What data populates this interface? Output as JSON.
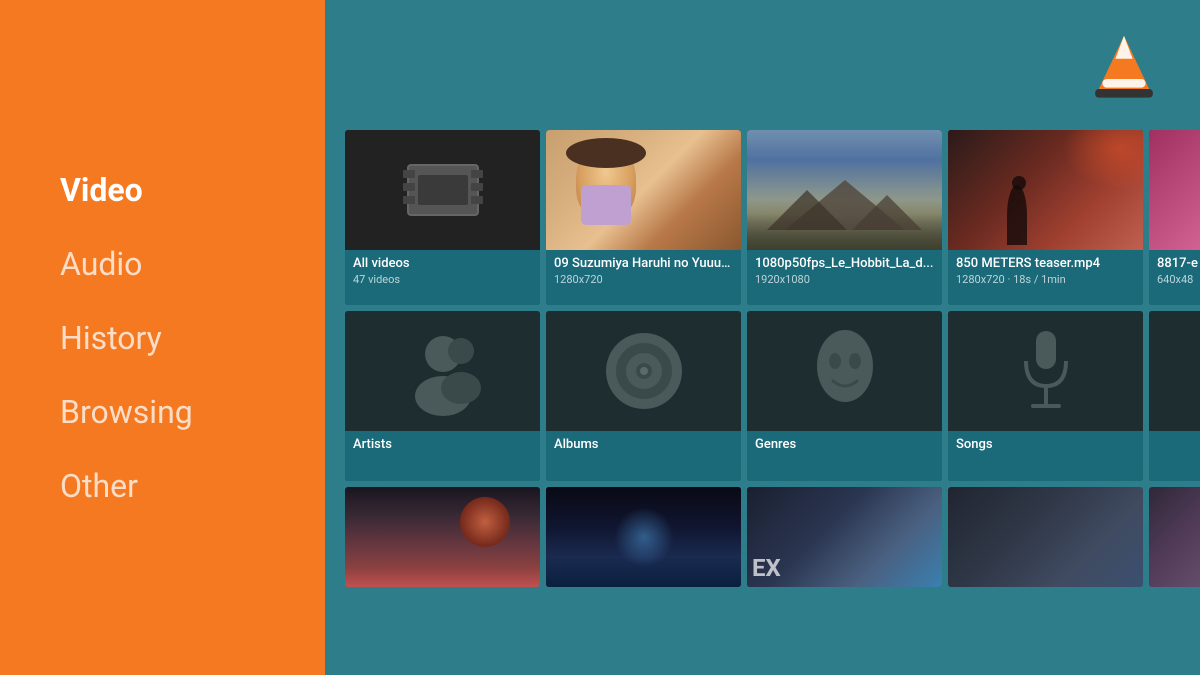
{
  "sidebar": {
    "nav_items": [
      {
        "id": "video",
        "label": "Video",
        "active": true
      },
      {
        "id": "audio",
        "label": "Audio",
        "active": false
      },
      {
        "id": "history",
        "label": "History",
        "active": false
      },
      {
        "id": "browsing",
        "label": "Browsing",
        "active": false
      },
      {
        "id": "other",
        "label": "Other",
        "active": false
      }
    ]
  },
  "vlc": {
    "logo_title": "VLC Media Player"
  },
  "video_row": {
    "tiles": [
      {
        "id": "all-videos",
        "title": "All videos",
        "subtitle": "47 videos",
        "type": "folder"
      },
      {
        "id": "suzumiya",
        "title": "09 Suzumiya Haruhi no Yuuut...",
        "subtitle": "1280x720",
        "type": "anime"
      },
      {
        "id": "hobbit",
        "title": "1080p50fps_Le_Hobbit_La_d...",
        "subtitle": "1920x1080",
        "type": "mountain"
      },
      {
        "id": "850meters",
        "title": "850 METERS teaser.mp4",
        "subtitle": "1280x720 · 18s / 1min",
        "type": "action"
      },
      {
        "id": "8817",
        "title": "8817-e",
        "subtitle": "640x48",
        "type": "partial"
      }
    ]
  },
  "music_row": {
    "tiles": [
      {
        "id": "artists",
        "label": "Artists",
        "icon": "person"
      },
      {
        "id": "albums",
        "label": "Albums",
        "icon": "disc"
      },
      {
        "id": "genres",
        "label": "Genres",
        "icon": "mask"
      },
      {
        "id": "songs",
        "label": "Songs",
        "icon": "mic"
      }
    ]
  },
  "bottom_row": {
    "tiles": [
      {
        "id": "scene1",
        "type": "scene1"
      },
      {
        "id": "scene2",
        "type": "scene2"
      },
      {
        "id": "scene3",
        "type": "scene3"
      },
      {
        "id": "scene4",
        "type": "scene4"
      },
      {
        "id": "scene5",
        "type": "scene5"
      }
    ]
  }
}
